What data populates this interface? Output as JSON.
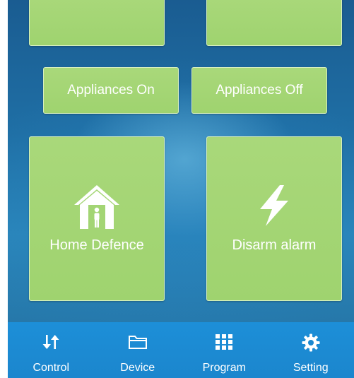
{
  "tiles": {
    "appliances_on": "Appliances On",
    "appliances_off": "Appliances Off",
    "home_defence": {
      "label": "Home Defence",
      "icon": "house-person-icon"
    },
    "disarm_alarm": {
      "label": "Disarm alarm",
      "icon": "lightning-icon"
    }
  },
  "navbar": {
    "items": [
      {
        "label": "Control",
        "icon": "swap-arrows-icon"
      },
      {
        "label": "Device",
        "icon": "folder-icon"
      },
      {
        "label": "Program",
        "icon": "grid-icon"
      },
      {
        "label": "Setting",
        "icon": "gear-icon"
      }
    ]
  },
  "colors": {
    "tile_green": "#a3d574",
    "navbar_blue": "#1b8ad2",
    "background_blue": "#1f6fa5"
  }
}
